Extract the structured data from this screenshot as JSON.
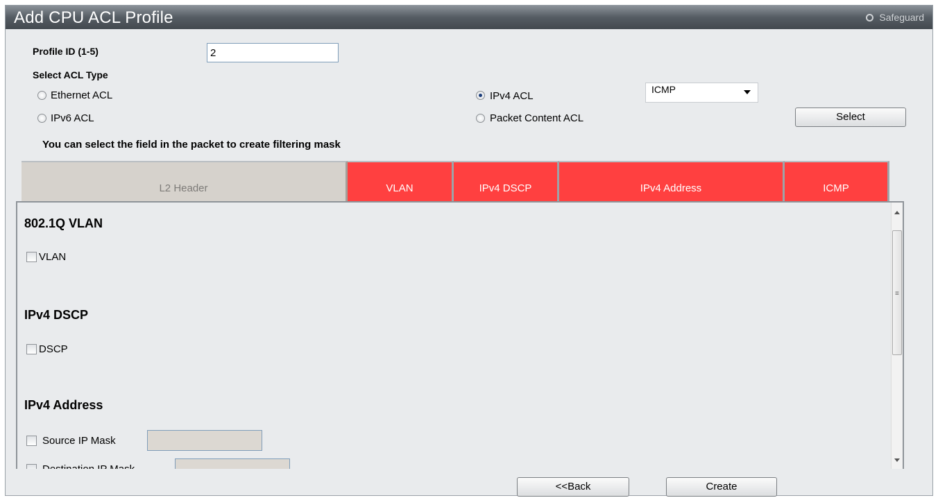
{
  "window": {
    "title": "Add CPU ACL Profile",
    "safeguard_label": "Safeguard"
  },
  "form": {
    "profile_id_label": "Profile ID (1-5)",
    "profile_id_value": "2",
    "acl_type_label": "Select ACL Type",
    "acl_types": {
      "ethernet": "Ethernet ACL",
      "ipv6": "IPv6 ACL",
      "ipv4": "IPv4 ACL",
      "packet_content": "Packet Content ACL"
    },
    "selected_acl_type": "IPv4 ACL",
    "protocol_select_value": "ICMP",
    "select_button": "Select",
    "hint": "You can select the field in the packet to create filtering mask"
  },
  "tabs": [
    {
      "label": "L2 Header"
    },
    {
      "label": "VLAN"
    },
    {
      "label": "IPv4 DSCP"
    },
    {
      "label": "IPv4 Address"
    },
    {
      "label": "ICMP"
    }
  ],
  "panel": {
    "vlan_section": "802.1Q VLAN",
    "vlan_checkbox": "VLAN",
    "dscp_section": "IPv4 DSCP",
    "dscp_checkbox": "DSCP",
    "address_section": "IPv4 Address",
    "source_ip_mask": "Source IP Mask",
    "destination_ip_mask": "Destination IP Mask"
  },
  "footer": {
    "back_button": "<<Back",
    "create_button": "Create"
  },
  "colors": {
    "tab_active_red": "#ff4040",
    "tab_inactive": "#d6d2cc",
    "title_bar": "#555c63"
  }
}
